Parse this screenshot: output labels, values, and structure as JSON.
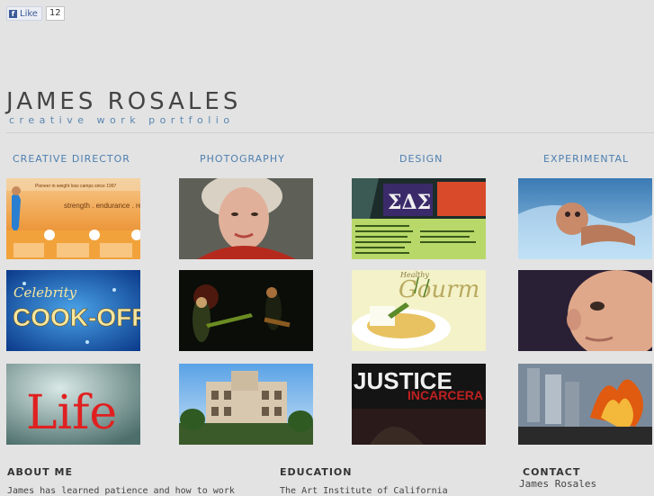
{
  "facebook": {
    "like_label": "Like",
    "like_count": "12"
  },
  "brand": {
    "name": "JAMES ROSALES",
    "tagline": "creative work portfolio"
  },
  "columns": [
    {
      "title": "CREATIVE DIRECTOR"
    },
    {
      "title": "PHOTOGRAPHY"
    },
    {
      "title": "DESIGN"
    },
    {
      "title": "EXPERIMENTAL"
    }
  ],
  "thumbnails": {
    "strength": {
      "text": "strength . endurance . re",
      "header": "Pioneer in weight loss camps since 1997"
    },
    "celebrity": {
      "line1": "Celebrity",
      "line2": "COOK-OFF"
    },
    "life": {
      "text": "Life"
    },
    "greek": {
      "letters": "ΣΔΣ"
    },
    "gourmet": {
      "text": "Gourm",
      "small": "Healthy"
    },
    "justice": {
      "line1": "JUSTICE",
      "line2": "INCARCERA"
    }
  },
  "footer": {
    "about_title": "ABOUT ME",
    "about_text": "James has learned patience and how to work",
    "education_title": "EDUCATION",
    "education_text": "The Art Institute of California",
    "contact_title": "CONTACT",
    "contact_name": "James Rosales"
  }
}
